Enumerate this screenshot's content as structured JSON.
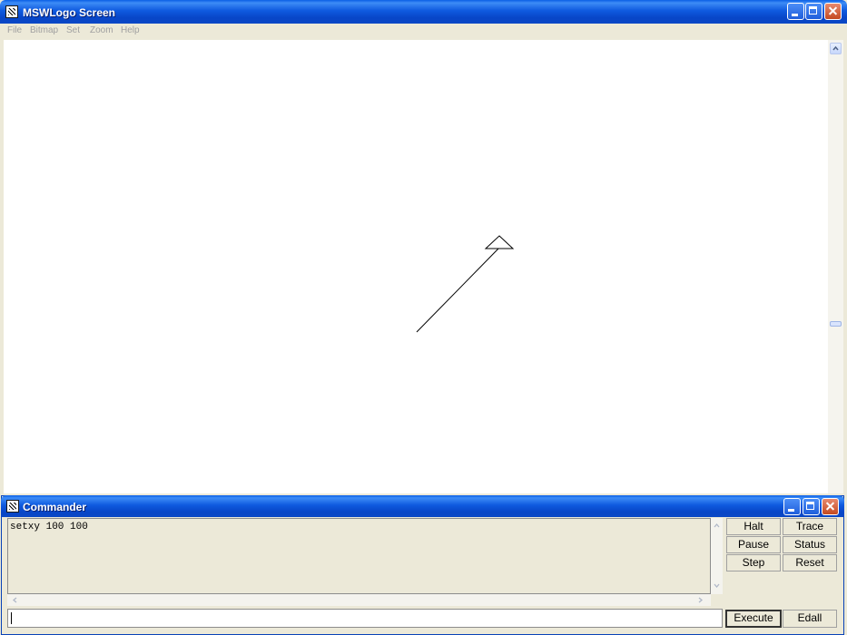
{
  "main_window": {
    "title": "MSWLogo Screen",
    "menu": [
      "File",
      "Bitmap",
      "Set",
      "Zoom",
      "Help"
    ]
  },
  "commander": {
    "title": "Commander",
    "output_lines": [
      "setxy 100 100"
    ],
    "input_value": "",
    "buttons": {
      "halt": "Halt",
      "trace": "Trace",
      "pause": "Pause",
      "status": "Status",
      "step": "Step",
      "reset": "Reset",
      "execute": "Execute",
      "edall": "Edall"
    }
  },
  "colors": {
    "titlebar": "#0A47C5",
    "close_button": "#C44A21",
    "canvas": "#FFFFFF",
    "chrome": "#ECE9D8"
  }
}
